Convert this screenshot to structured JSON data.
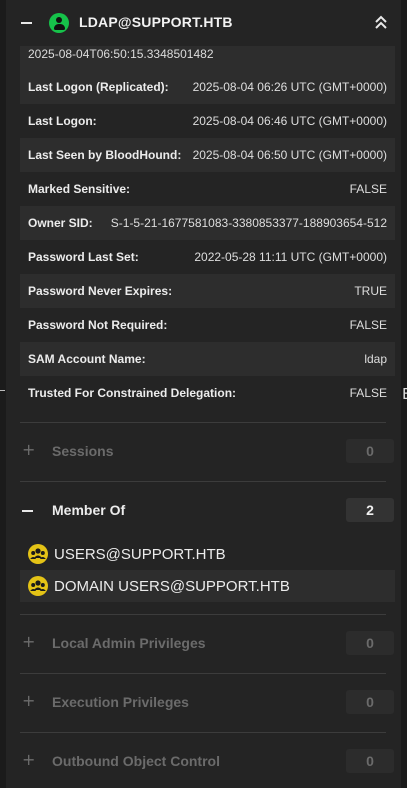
{
  "header": {
    "title": "LDAP@SUPPORT.HTB",
    "user_icon": "user-icon",
    "collapse_icon": "chevrons-up-icon"
  },
  "properties": {
    "partial_value": "2025-08-04T06:50:15.3348501482",
    "rows": [
      {
        "label": "Last Logon (Replicated):",
        "value": "2025-08-04 06:26 UTC (GMT+0000)"
      },
      {
        "label": "Last Logon:",
        "value": "2025-08-04 06:46 UTC (GMT+0000)"
      },
      {
        "label": "Last Seen by BloodHound:",
        "value": "2025-08-04 06:50 UTC (GMT+0000)"
      },
      {
        "label": "Marked Sensitive:",
        "value": "FALSE"
      },
      {
        "label": "Owner SID:",
        "value": "S-1-5-21-1677581083-3380853377-188903654-512"
      },
      {
        "label": "Password Last Set:",
        "value": "2022-05-28 11:11 UTC (GMT+0000)"
      },
      {
        "label": "Password Never Expires:",
        "value": "TRUE"
      },
      {
        "label": "Password Not Required:",
        "value": "FALSE"
      },
      {
        "label": "SAM Account Name:",
        "value": "ldap"
      },
      {
        "label": "Trusted For Constrained Delegation:",
        "value": "FALSE"
      }
    ]
  },
  "sections": {
    "sessions": {
      "title": "Sessions",
      "count": "0"
    },
    "member_of": {
      "title": "Member Of",
      "count": "2",
      "items": [
        "USERS@SUPPORT.HTB",
        "DOMAIN USERS@SUPPORT.HTB"
      ]
    },
    "local_admin": {
      "title": "Local Admin Privileges",
      "count": "0"
    },
    "execution": {
      "title": "Execution Privileges",
      "count": "0"
    },
    "outbound": {
      "title": "Outbound Object Control",
      "count": "0"
    }
  },
  "colors": {
    "user_icon": "#16c24a",
    "group_icon": "#e4c316",
    "background": "#242424",
    "row_alt": "#2d2d2d"
  }
}
